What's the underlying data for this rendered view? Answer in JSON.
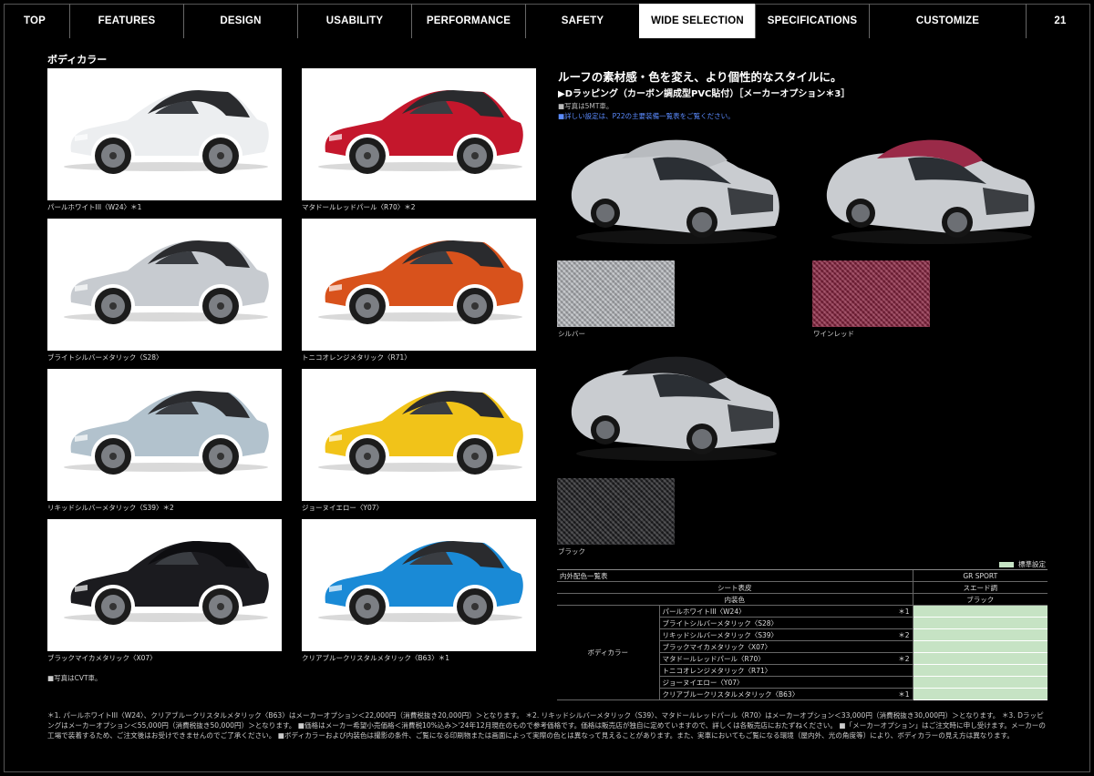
{
  "nav": {
    "tabs": [
      "TOP",
      "FEATURES",
      "DESIGN",
      "USABILITY",
      "PERFORMANCE",
      "SAFETY",
      "WIDE SELECTION",
      "SPECIFICATIONS",
      "CUSTOMIZE"
    ],
    "active": "WIDE SELECTION",
    "page_number": "21"
  },
  "body_color": {
    "title": "ボディカラー",
    "swatches": [
      {
        "label": "パールホワイトIII〈W24〉＊1",
        "color": "#eceef0"
      },
      {
        "label": "マタドールレッドパール〈R70〉＊2",
        "color": "#c4172c"
      },
      {
        "label": "ブライトシルバーメタリック〈S28〉",
        "color": "#c7cbd0"
      },
      {
        "label": "トニコオレンジメタリック〈R71〉",
        "color": "#d8521c"
      },
      {
        "label": "リキッドシルバーメタリック〈S39〉＊2",
        "color": "#b2c2cd"
      },
      {
        "label": "ジョーヌイエロー〈Y07〉",
        "color": "#f1c319"
      },
      {
        "label": "ブラックマイカメタリック〈X07〉",
        "color": "#1b1b1f"
      },
      {
        "label": "クリアブルークリスタルメタリック〈B63〉＊1",
        "color": "#1a8ad6"
      }
    ],
    "photo_note": "■写真はCVT車。"
  },
  "wrap": {
    "heading": "ルーフの素材感・色を変え、より個性的なスタイルに。",
    "subheading": "▶Dラッピング（カーボン調成型PVC貼付）［メーカーオプション＊3］",
    "note1": "■写真は5MT車。",
    "note2": "■詳しい設定は、P22の主要装備一覧表をご覧ください。",
    "materials": [
      {
        "label": "シルバー",
        "color": "#b9bcc0"
      },
      {
        "label": "ワインレッド",
        "color": "#8a2340"
      },
      {
        "label": "ブラック",
        "color": "#1f1f22"
      }
    ]
  },
  "table": {
    "legend": "標準設定",
    "title": "内外配色一覧表",
    "grade": "GR SPORT",
    "seat_label": "シート表皮",
    "seat_value": "スエード調",
    "interior_label": "内装色",
    "interior_value": "ブラック",
    "group_label": "ボディカラー",
    "rows": [
      {
        "name": "パールホワイトIII〈W24〉",
        "mark": "＊1"
      },
      {
        "name": "ブライトシルバーメタリック〈S28〉",
        "mark": ""
      },
      {
        "name": "リキッドシルバーメタリック〈S39〉",
        "mark": "＊2"
      },
      {
        "name": "ブラックマイカメタリック〈X07〉",
        "mark": ""
      },
      {
        "name": "マタドールレッドパール〈R70〉",
        "mark": "＊2"
      },
      {
        "name": "トニコオレンジメタリック〈R71〉",
        "mark": ""
      },
      {
        "name": "ジョーヌイエロー〈Y07〉",
        "mark": ""
      },
      {
        "name": "クリアブルークリスタルメタリック〈B63〉",
        "mark": "＊1"
      }
    ]
  },
  "footnote": "＊1. パールホワイトIII〈W24〉、クリアブルークリスタルメタリック〈B63〉はメーカーオプション＜22,000円（消費税抜き20,000円）＞となります。 ＊2. リキッドシルバーメタリック〈S39〉、マタドールレッドパール〈R70〉はメーカーオプション＜33,000円（消費税抜き30,000円）＞となります。 ＊3. Dラッピングはメーカーオプション＜55,000円（消費税抜き50,000円）＞となります。 ■価格はメーカー希望小売価格＜消費税10%込み＞'24年12月現在のもので参考価格です。価格は販売店が独自に定めていますので、詳しくは各販売店におたずねください。 ■「メーカーオプション」はご注文時に申し受けます。メーカーの工場で装着するため、ご注文後はお受けできませんのでご了承ください。 ■ボディカラーおよび内装色は撮影の条件、ご覧になる印刷物または画面によって実際の色とは異なって見えることがあります。また、実車においてもご覧になる環境（屋内外、光の角度等）により、ボディカラーの見え方は異なります。"
}
